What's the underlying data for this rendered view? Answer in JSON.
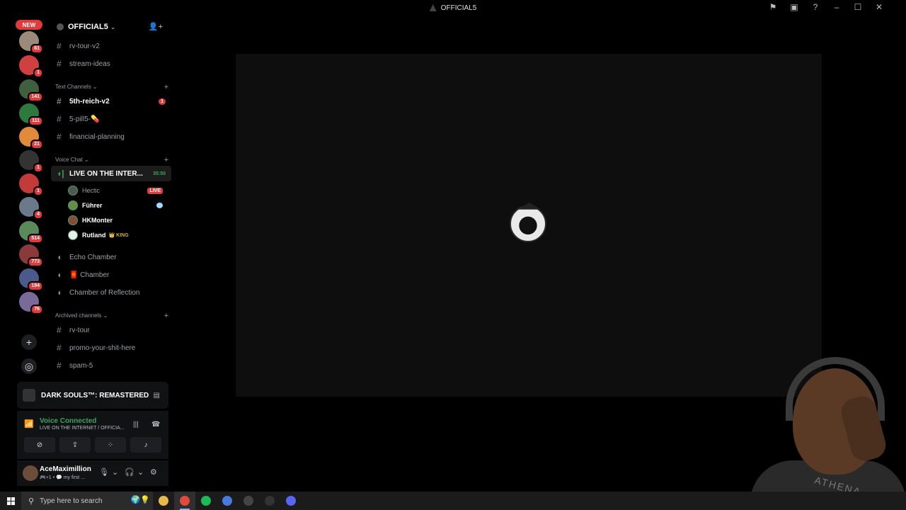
{
  "window": {
    "title": "OFFICIAL5",
    "buttons": [
      "flag-icon",
      "inbox-icon",
      "help-icon",
      "minimize-icon",
      "maximize-icon",
      "close-icon"
    ]
  },
  "rail": {
    "new_label": "NEW",
    "servers": [
      {
        "count": "61",
        "color": "#9a8a7a"
      },
      {
        "count": "1",
        "color": "#d04040"
      },
      {
        "count": "141",
        "color": "#3f5f3f"
      },
      {
        "count": "111",
        "color": "#2e7a3e"
      },
      {
        "count": "21",
        "color": "#e08a3a"
      },
      {
        "count": "1",
        "color": "#333333"
      },
      {
        "count": "1",
        "color": "#c23a3a"
      },
      {
        "count": "4",
        "color": "#6a7a8a"
      },
      {
        "count": "514",
        "color": "#5a8a5a"
      },
      {
        "count": "773",
        "color": "#8a3a3a"
      },
      {
        "count": "194",
        "color": "#4a5a8a"
      },
      {
        "count": "76",
        "color": "#7a6a9a"
      }
    ],
    "add_server": "+",
    "explore": "◎"
  },
  "server": {
    "name": "OFFICIAL5",
    "chevron": "⌄",
    "invite": "👤+"
  },
  "channels_top": [
    {
      "name": "rv-tour-v2"
    },
    {
      "name": "stream-ideas"
    }
  ],
  "text_category": {
    "label": "Text Channels ⌄",
    "plus": "+"
  },
  "text_channels": [
    {
      "name": "5th-reich-v2",
      "badge": "1"
    },
    {
      "name": "5-pill5-💊"
    },
    {
      "name": "financial-planning"
    }
  ],
  "voice_category": {
    "label": "Voice Chat ⌄",
    "plus": "+"
  },
  "active_voice": {
    "name": "LIVE ON THE INTER...",
    "timer": "35:50"
  },
  "voice_users": [
    {
      "name": "Hectic",
      "live": "LIVE",
      "color": "#555"
    },
    {
      "name": "Führer",
      "color": "#6a8a4a"
    },
    {
      "name": "HKMonter",
      "color": "#8a4a3a"
    },
    {
      "name": "Rutland",
      "tag": "👑 KING",
      "color": "#eee"
    }
  ],
  "voice_channels": [
    {
      "name": "Echo Chamber"
    },
    {
      "name": "🧧 Chamber"
    },
    {
      "name": "Chamber of Reflection"
    }
  ],
  "archived_category": {
    "label": "Archived channels ⌄",
    "plus": "+"
  },
  "archived_channels": [
    {
      "name": "rv-tour"
    },
    {
      "name": "promo-your-shit-here"
    },
    {
      "name": "spam-5"
    }
  ],
  "activity": {
    "game": "DARK SOULS™: REMASTERED"
  },
  "voice_status": {
    "title": "Voice Connected",
    "subtitle": "LIVE ON THE INTERNET / OFFICIA..."
  },
  "user": {
    "name": "AceMaximillion",
    "status": "🎮+1 • 💬 my first ..."
  },
  "taskbar": {
    "search_placeholder": "Type here to search",
    "apps": [
      {
        "name": "file-explorer",
        "color": "#e8b84a"
      },
      {
        "name": "chrome",
        "color": "#e04a3a"
      },
      {
        "name": "spotify",
        "color": "#1db954"
      },
      {
        "name": "app-blue",
        "color": "#4a7ad8"
      },
      {
        "name": "obs",
        "color": "#444"
      },
      {
        "name": "game",
        "color": "#333"
      },
      {
        "name": "discord",
        "color": "#5865f2"
      }
    ]
  },
  "webcam": {
    "shirt_text": "ATHENA"
  }
}
